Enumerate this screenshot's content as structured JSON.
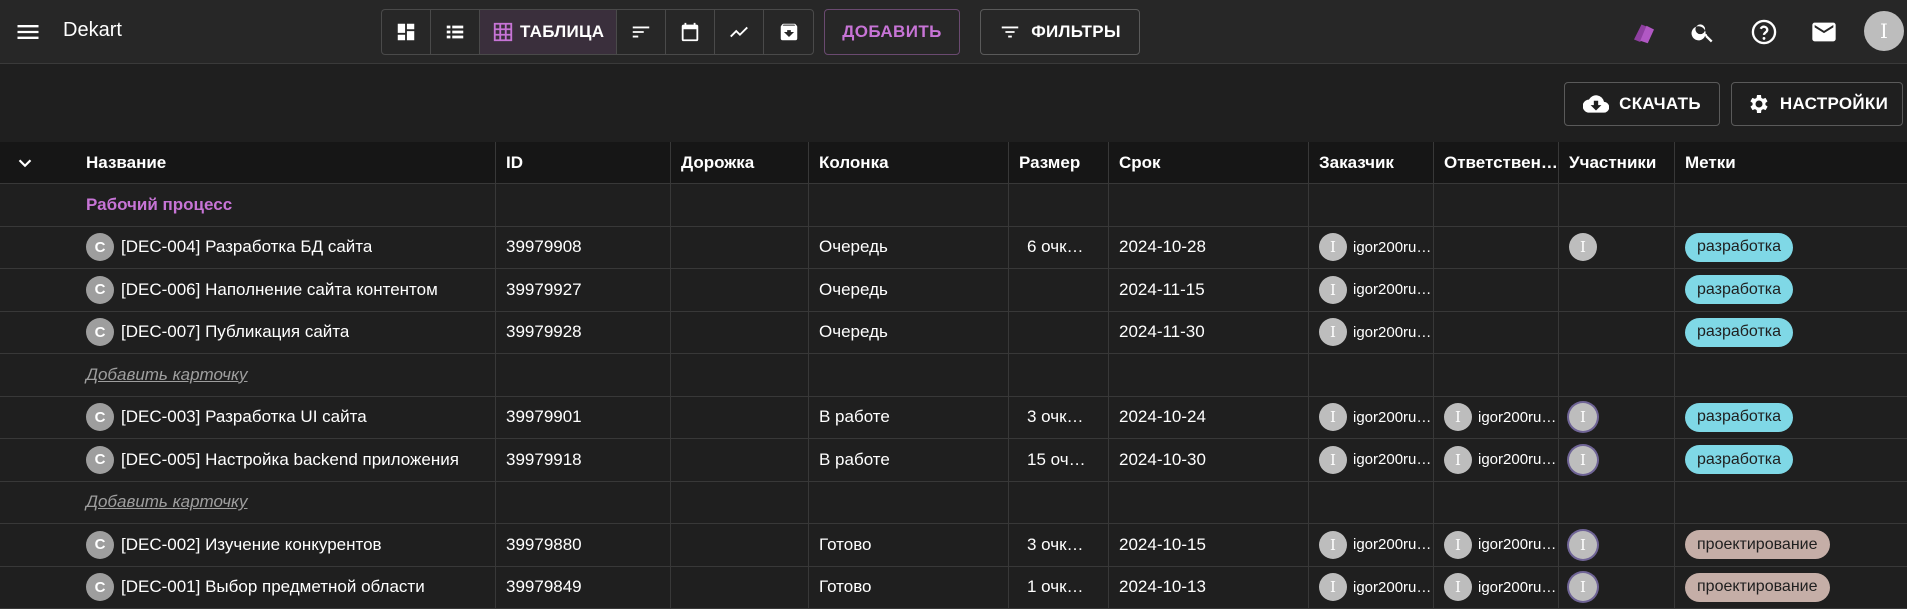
{
  "app": {
    "title": "Dekart",
    "user_initial": "I"
  },
  "toolbar": {
    "table_label": "ТАБЛИЦА",
    "add_label": "ДОБАВИТЬ",
    "filters_label": "ФИЛЬТРЫ"
  },
  "actions": {
    "download_label": "СКАЧАТЬ",
    "settings_label": "НАСТРОЙКИ"
  },
  "colors": {
    "accent": "#c774d6",
    "tag_dev": "#7fd8e6",
    "tag_design": "#c5aea7"
  },
  "table": {
    "headers": [
      "Название",
      "ID",
      "Дорожка",
      "Колонка",
      "Размер",
      "Срок",
      "Заказчик",
      "Ответствен…",
      "Участники",
      "Метки"
    ],
    "group_title": "Рабочий процесс",
    "add_card_label": "Добавить карточку",
    "card_initial": "C",
    "rows": [
      {
        "title": "[DEC-004] Разработка БД сайта",
        "id": "39979908",
        "column": "Очередь",
        "size": "6 очк…",
        "due": "2024-10-28",
        "customer": "igor200ru…",
        "responsible": "",
        "participants": true,
        "tag": "разработка",
        "tag_type": "dev"
      },
      {
        "title": "[DEC-006] Наполнение сайта контентом",
        "id": "39979927",
        "column": "Очередь",
        "size": "",
        "due": "2024-11-15",
        "customer": "igor200ru…",
        "responsible": "",
        "participants": false,
        "tag": "разработка",
        "tag_type": "dev"
      },
      {
        "title": "[DEC-007] Публикация сайта",
        "id": "39979928",
        "column": "Очередь",
        "size": "",
        "due": "2024-11-30",
        "customer": "igor200ru…",
        "responsible": "",
        "participants": false,
        "tag": "разработка",
        "tag_type": "dev"
      },
      {
        "title": "[DEC-003] Разработка UI сайта",
        "id": "39979901",
        "column": "В работе",
        "size": "3 очк…",
        "due": "2024-10-24",
        "customer": "igor200ru…",
        "responsible": "igor200ru…",
        "participants": true,
        "tag": "разработка",
        "tag_type": "dev"
      },
      {
        "title": "[DEC-005] Настройка backend приложения",
        "id": "39979918",
        "column": "В работе",
        "size": "15 оч…",
        "due": "2024-10-30",
        "customer": "igor200ru…",
        "responsible": "igor200ru…",
        "participants": true,
        "tag": "разработка",
        "tag_type": "dev"
      },
      {
        "title": "[DEC-002] Изучение конкурентов",
        "id": "39979880",
        "column": "Готово",
        "size": "3 очк…",
        "due": "2024-10-15",
        "customer": "igor200ru…",
        "responsible": "igor200ru…",
        "participants": true,
        "tag": "проектирование",
        "tag_type": "design"
      },
      {
        "title": "[DEC-001] Выбор предметной области",
        "id": "39979849",
        "column": "Готово",
        "size": "1 очк…",
        "due": "2024-10-13",
        "customer": "igor200ru…",
        "responsible": "igor200ru…",
        "participants": true,
        "tag": "проектирование",
        "tag_type": "design"
      }
    ]
  }
}
